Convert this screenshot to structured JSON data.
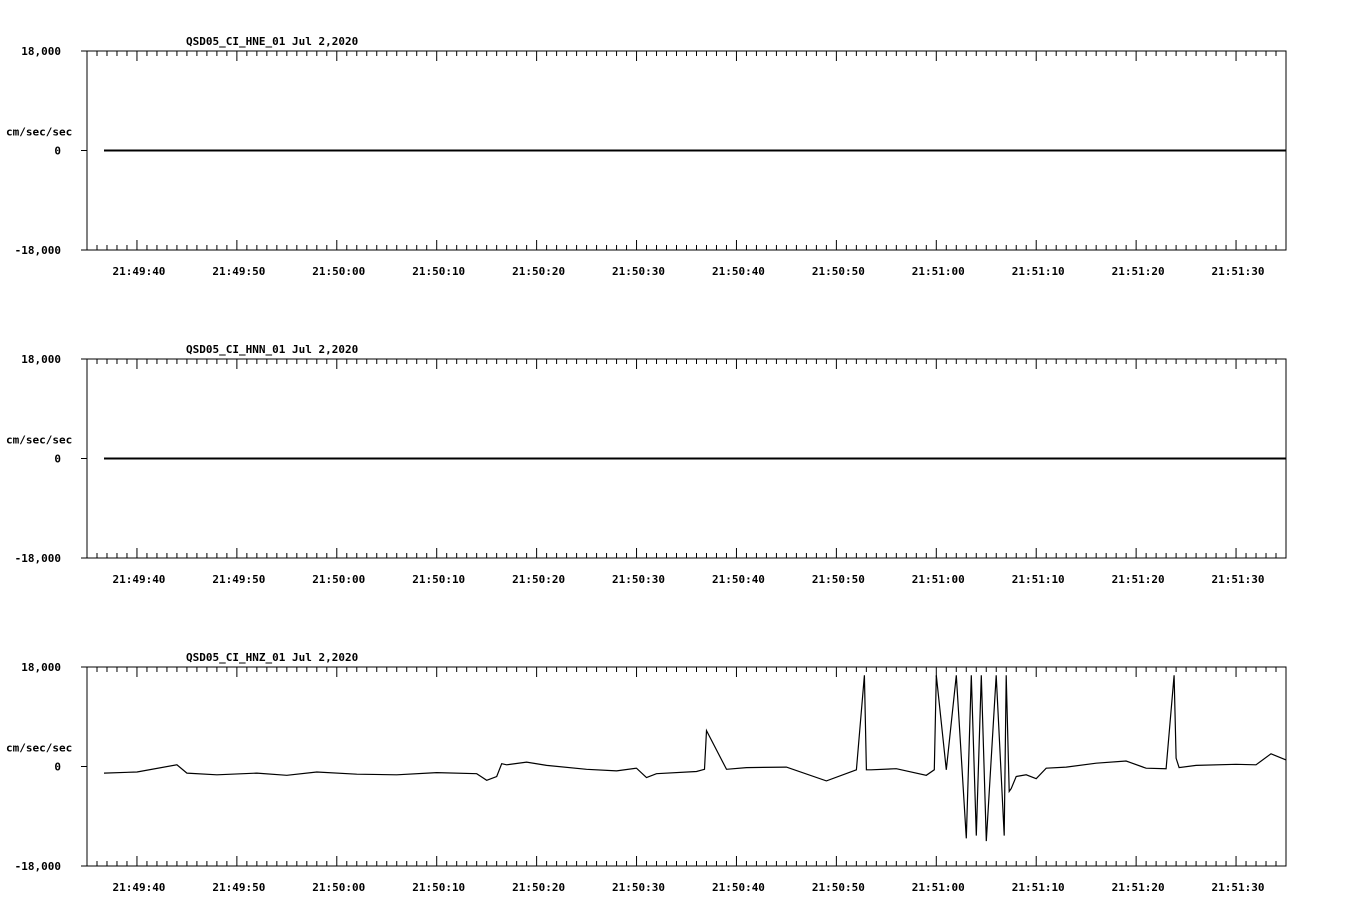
{
  "chart_data": [
    {
      "type": "line",
      "title": "QSD05_CI_HNE_01  Jul 2,2020",
      "ylabel": "cm/sec/sec",
      "ylim": [
        -18,
        18
      ],
      "y_tick_labels": [
        "18,000",
        "0",
        "-18,000"
      ],
      "x_tick_labels": [
        "21:49:40",
        "21:49:50",
        "21:50:00",
        "21:50:10",
        "21:50:20",
        "21:50:30",
        "21:50:40",
        "21:50:50",
        "21:51:00",
        "21:51:10",
        "21:51:20",
        "21:51:30"
      ],
      "xlim_seconds_after_21_49_40": [
        -5,
        115
      ],
      "series": [
        {
          "x": [
            -3.3,
            115
          ],
          "y": [
            0,
            0
          ]
        }
      ]
    },
    {
      "type": "line",
      "title": "QSD05_CI_HNN_01  Jul 2,2020",
      "ylabel": "cm/sec/sec",
      "ylim": [
        -18,
        18
      ],
      "y_tick_labels": [
        "18,000",
        "0",
        "-18,000"
      ],
      "x_tick_labels": [
        "21:49:40",
        "21:49:50",
        "21:50:00",
        "21:50:10",
        "21:50:20",
        "21:50:30",
        "21:50:40",
        "21:50:50",
        "21:51:00",
        "21:51:10",
        "21:51:20",
        "21:51:30"
      ],
      "xlim_seconds_after_21_49_40": [
        -5,
        115
      ],
      "series": [
        {
          "x": [
            -3.3,
            115
          ],
          "y": [
            0,
            0
          ]
        }
      ]
    },
    {
      "type": "line",
      "title": "QSD05_CI_HNZ_01  Jul 2,2020",
      "ylabel": "cm/sec/sec",
      "ylim": [
        -18,
        18
      ],
      "y_tick_labels": [
        "18,000",
        "0",
        "-18,000"
      ],
      "x_tick_labels": [
        "21:49:40",
        "21:49:50",
        "21:50:00",
        "21:50:10",
        "21:50:20",
        "21:50:30",
        "21:50:40",
        "21:50:50",
        "21:51:00",
        "21:51:10",
        "21:51:20",
        "21:51:30"
      ],
      "xlim_seconds_after_21_49_40": [
        -5,
        115
      ],
      "series": [
        {
          "x": [
            -3.3,
            0,
            4,
            5,
            8,
            12,
            15,
            18,
            22,
            26,
            30,
            34,
            34.5,
            35,
            36,
            36.5,
            37,
            39,
            41,
            45,
            48,
            50,
            51,
            52,
            56,
            56.8,
            57,
            59,
            61,
            65,
            69,
            72,
            72.8,
            73,
            73.5,
            76,
            79,
            79.8,
            80,
            81,
            82,
            83,
            83.5,
            84,
            84.5,
            85,
            86,
            86.8,
            87,
            87.3,
            87.5,
            88,
            89,
            90,
            91,
            93,
            96,
            99,
            101,
            103,
            103.8,
            104,
            104.3,
            106,
            110,
            112,
            113.5,
            115
          ],
          "y": [
            -1.2,
            -1,
            0.3,
            -1.2,
            -1.5,
            -1.2,
            -1.6,
            -1,
            -1.4,
            -1.5,
            -1.1,
            -1.3,
            -1.9,
            -2.5,
            -1.8,
            0.5,
            0.3,
            0.8,
            0.2,
            -0.5,
            -0.8,
            -0.3,
            -2,
            -1.3,
            -0.9,
            -0.5,
            6.5,
            -0.5,
            -0.2,
            -0.1,
            -2.6,
            -0.6,
            16.5,
            -0.6,
            -0.6,
            -0.4,
            -1.6,
            -0.6,
            16.5,
            -0.6,
            16.5,
            -13,
            16.5,
            -12.5,
            16.5,
            -13.5,
            16.5,
            -12.5,
            16.5,
            -4.5,
            -4,
            -1.8,
            -1.5,
            -2.2,
            -0.3,
            -0.1,
            0.6,
            1,
            -0.3,
            -0.4,
            16.5,
            1.5,
            -0.2,
            0.2,
            0.4,
            0.3,
            2.3,
            1.2
          ]
        }
      ]
    }
  ]
}
